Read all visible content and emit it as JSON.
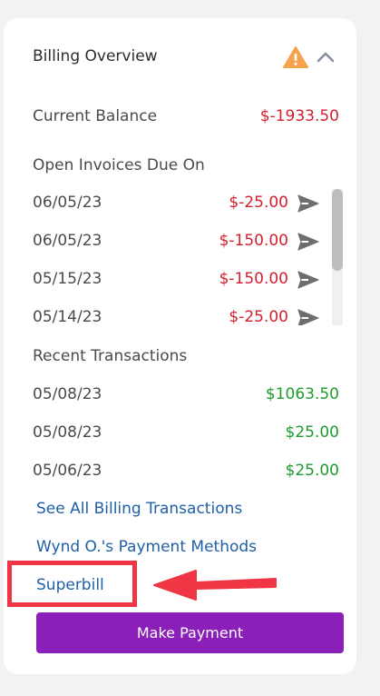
{
  "billing": {
    "title": "Billing Overview",
    "current_balance_label": "Current Balance",
    "current_balance_value": "$-1933.50",
    "open_invoices_label": "Open Invoices Due On",
    "invoices": [
      {
        "date": "06/05/23",
        "amount": "$-25.00"
      },
      {
        "date": "06/05/23",
        "amount": "$-150.00"
      },
      {
        "date": "05/15/23",
        "amount": "$-150.00"
      },
      {
        "date": "05/14/23",
        "amount": "$-25.00"
      }
    ],
    "recent_transactions_label": "Recent Transactions",
    "transactions": [
      {
        "date": "05/08/23",
        "amount": "$1063.50"
      },
      {
        "date": "05/08/23",
        "amount": "$25.00"
      },
      {
        "date": "05/06/23",
        "amount": "$25.00"
      }
    ],
    "links": {
      "see_all": "See All Billing Transactions",
      "payment_methods": "Wynd O.'s Payment Methods",
      "superbill": "Superbill"
    },
    "make_payment_label": "Make Payment"
  },
  "colors": {
    "negative": "#d1202f",
    "positive": "#1e9a2e",
    "link": "#1f5fa8",
    "button": "#8b1fb9",
    "warning": "#f5a24a",
    "highlight": "#f03545"
  },
  "icons": {
    "warning": "warning-triangle-icon",
    "collapse": "chevron-up-icon",
    "send": "send-arrow-icon"
  }
}
